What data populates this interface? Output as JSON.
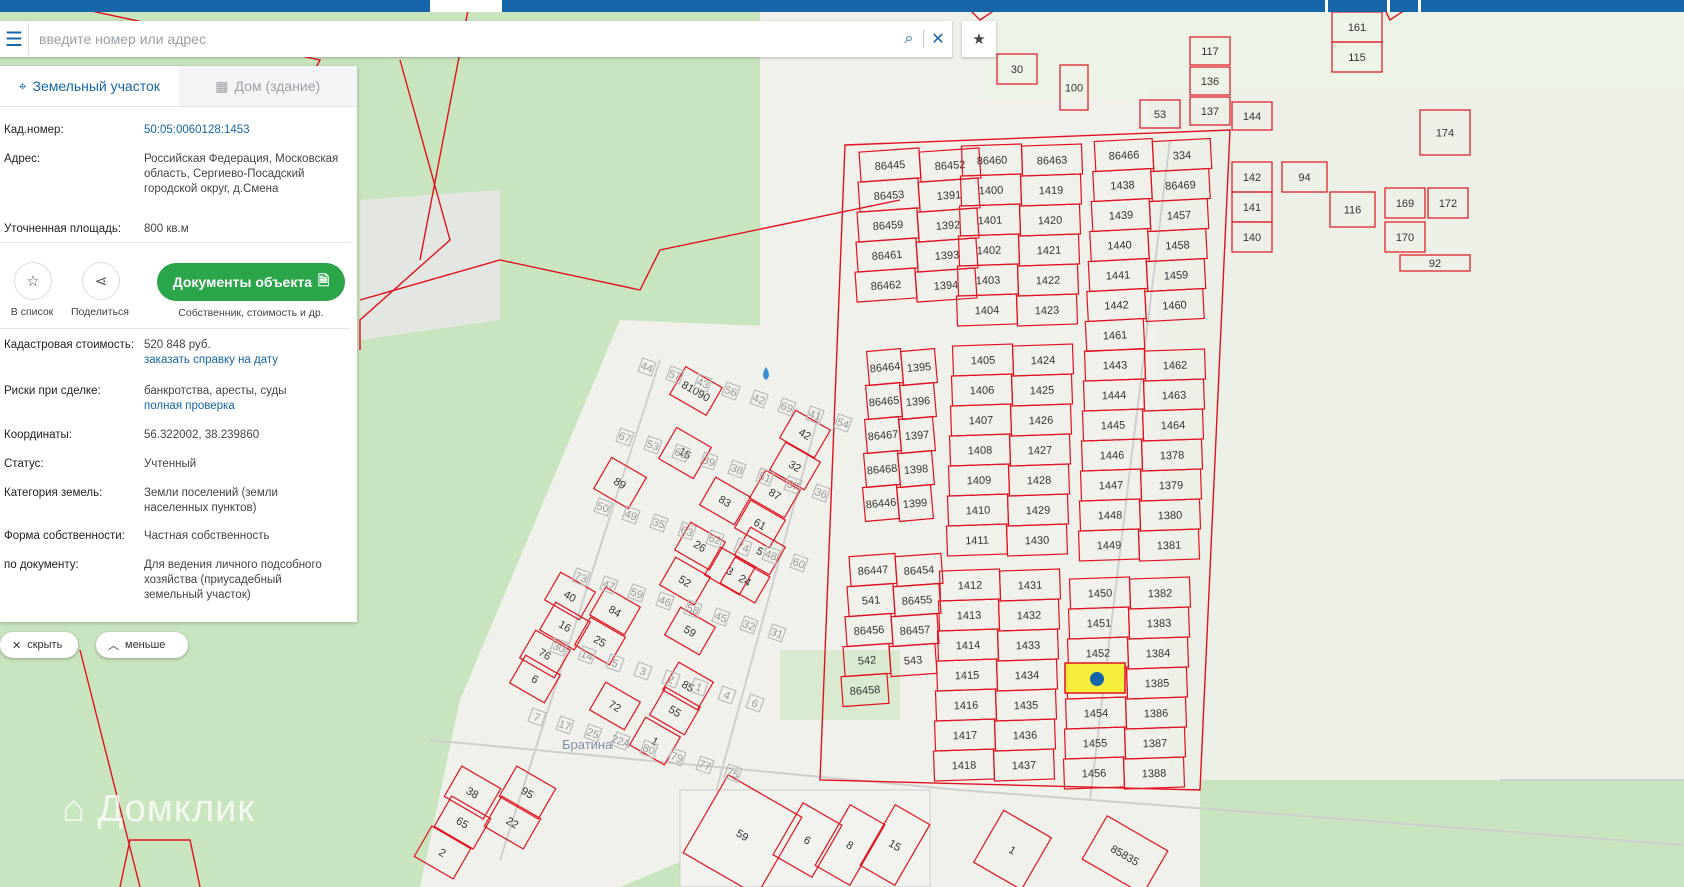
{
  "search": {
    "placeholder": "введите номер или адрес"
  },
  "tabs": [
    {
      "label": "Земельный участок"
    },
    {
      "label": "Дом (здание)"
    }
  ],
  "info": {
    "cad_label": "Кад.номер:",
    "cad_value": "50:05:0060128:1453",
    "addr_label": "Адрес:",
    "addr_value": "Российская Федерация, Московская область, Сергиево-Посадский городской округ, д.Смена",
    "area_label": "Уточненная площадь:",
    "area_value": "800 кв.м",
    "cost_label": "Кадастровая стоимость:",
    "cost_value": "520 848 руб.",
    "cost_link": "заказать справку на дату",
    "risk_label": "Риски при сделке:",
    "risk_value": "банкротства, аресты, суды",
    "risk_link": "полная проверка",
    "coord_label": "Координаты:",
    "coord_value": "56.322002, 38.239860",
    "status_label": "Статус:",
    "status_value": "Учтенный",
    "cat_label": "Категория земель:",
    "cat_value": "Земли поселений (земли населенных пунктов)",
    "own_label": "Форма собственности:",
    "own_value": "Частная собственность",
    "doc_label": "по документу:",
    "doc_value": "Для ведения личного подсобного хозяйства (приусадебный земельный участок)"
  },
  "actions": {
    "save_label": "В список",
    "share_label": "Поделиться",
    "docs_button": "Документы объекта",
    "docs_caption": "Собственник, стоимость и др."
  },
  "pills": {
    "hide": "скрыть",
    "less": "меньше"
  },
  "logo": "Домклик",
  "street": "Братина",
  "colors": {
    "brand": "#1565a8",
    "parcel": "#e0121f",
    "highlight": "#f5ef3b",
    "button": "#2aa54a",
    "forest": "#c9e5bf"
  },
  "parcels_left": [
    "86445",
    "86452",
    "86453",
    "1391",
    "86459",
    "1392",
    "86461",
    "1393",
    "86462",
    "1394"
  ],
  "parcels_a": [
    "86460",
    "86463",
    "1400",
    "1419",
    "1401",
    "1420",
    "1402",
    "1421",
    "1403",
    "1422",
    "1404",
    "1423"
  ],
  "parcels_b": [
    "86466",
    "334",
    "1438",
    "86469",
    "1439",
    "1457",
    "1440",
    "1458",
    "1441",
    "1459",
    "1442",
    "1460",
    "1461"
  ],
  "parcels_c": [
    "1405",
    "1424",
    "1406",
    "1425",
    "1407",
    "1426",
    "1408",
    "1427",
    "1409",
    "1428",
    "1410",
    "1429",
    "1411",
    "1430"
  ],
  "parcels_c2": [
    "86464",
    "1395",
    "86465",
    "1396",
    "86467",
    "1397",
    "86468",
    "1398",
    "86446",
    "1399"
  ],
  "parcels_d": [
    "1443",
    "1462",
    "1444",
    "1463",
    "1445",
    "1464",
    "1446",
    "1378",
    "1447",
    "1379",
    "1448",
    "1380",
    "1449",
    "1381"
  ],
  "parcels_e": [
    "1412",
    "1431",
    "1413",
    "1432",
    "1414",
    "1433",
    "1415",
    "1434",
    "1416",
    "1435",
    "1417",
    "1436",
    "1418",
    "1437"
  ],
  "parcels_f": [
    "1450",
    "1382",
    "1451",
    "1383",
    "1452",
    "1384",
    "1453",
    "1385",
    "1454",
    "1386",
    "1455",
    "1387",
    "1456",
    "1388"
  ],
  "parcels_g": [
    "86447",
    "86454",
    "541",
    "86455",
    "86456",
    "86457",
    "542",
    "543",
    "86458"
  ],
  "parcels_top": [
    "117",
    "136",
    "137",
    "144",
    "161",
    "115",
    "53",
    "30",
    "100",
    "174",
    "142",
    "94",
    "141",
    "140",
    "116",
    "169",
    "172",
    "170",
    "92"
  ],
  "parcels_village": [
    "81090",
    "15",
    "89",
    "42",
    "32",
    "83",
    "87",
    "61",
    "26",
    "5",
    "3",
    "24",
    "52",
    "40",
    "84",
    "16",
    "25",
    "76",
    "6",
    "59",
    "85",
    "55",
    "1",
    "72",
    "38",
    "95",
    "65",
    "22",
    "2",
    "59",
    "6",
    "8",
    "15",
    "1",
    "85835"
  ],
  "village_gray": [
    "44",
    "57",
    "43",
    "56",
    "42",
    "69",
    "41",
    "54",
    "67",
    "53",
    "65",
    "39",
    "38",
    "51",
    "37",
    "36",
    "50",
    "49",
    "35",
    "63",
    "62",
    "74",
    "48",
    "60",
    "73",
    "47",
    "59",
    "46",
    "58",
    "45",
    "32",
    "31",
    "30",
    "14",
    "5",
    "3",
    "2",
    "1",
    "4",
    "6",
    "7",
    "17",
    "25",
    "22A",
    "80",
    "79",
    "77",
    "75"
  ]
}
